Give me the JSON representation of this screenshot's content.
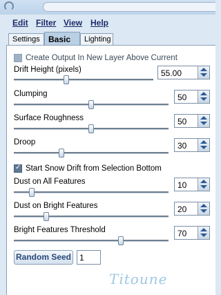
{
  "menu": {
    "edit": "Edit",
    "filter": "Filter",
    "view": "View",
    "help": "Help"
  },
  "tabs": {
    "settings": "Settings",
    "basic": "Basic",
    "lighting": "Lighting"
  },
  "options": {
    "create_output_label": "Create Output In New Layer Above Current",
    "create_output_checked": false,
    "snow_drift_label": "Start Snow Drift from Selection Bottom",
    "snow_drift_checked": true
  },
  "params": {
    "drift_height": {
      "label": "Drift Height (pixels)",
      "value": "55.00",
      "level": 0.37
    },
    "clumping": {
      "label": "Clumping",
      "value": "50",
      "level": 0.5
    },
    "surface_roughness": {
      "label": "Surface Roughness",
      "value": "50",
      "level": 0.5
    },
    "droop": {
      "label": "Droop",
      "value": "30",
      "level": 0.3
    },
    "dust_all": {
      "label": "Dust on All Features",
      "value": "10",
      "level": 0.1
    },
    "dust_bright": {
      "label": "Dust on Bright Features",
      "value": "20",
      "level": 0.2
    },
    "bright_threshold": {
      "label": "Bright Features Threshold",
      "value": "70",
      "level": 0.7
    }
  },
  "seed": {
    "button_label": "Random Seed",
    "value": "1"
  },
  "watermark": "Titoune",
  "colors": {
    "background": "#dce8f3",
    "panel": "#ffffff",
    "accent": "#2b5a95",
    "menu_text": "#1b2a6b"
  }
}
